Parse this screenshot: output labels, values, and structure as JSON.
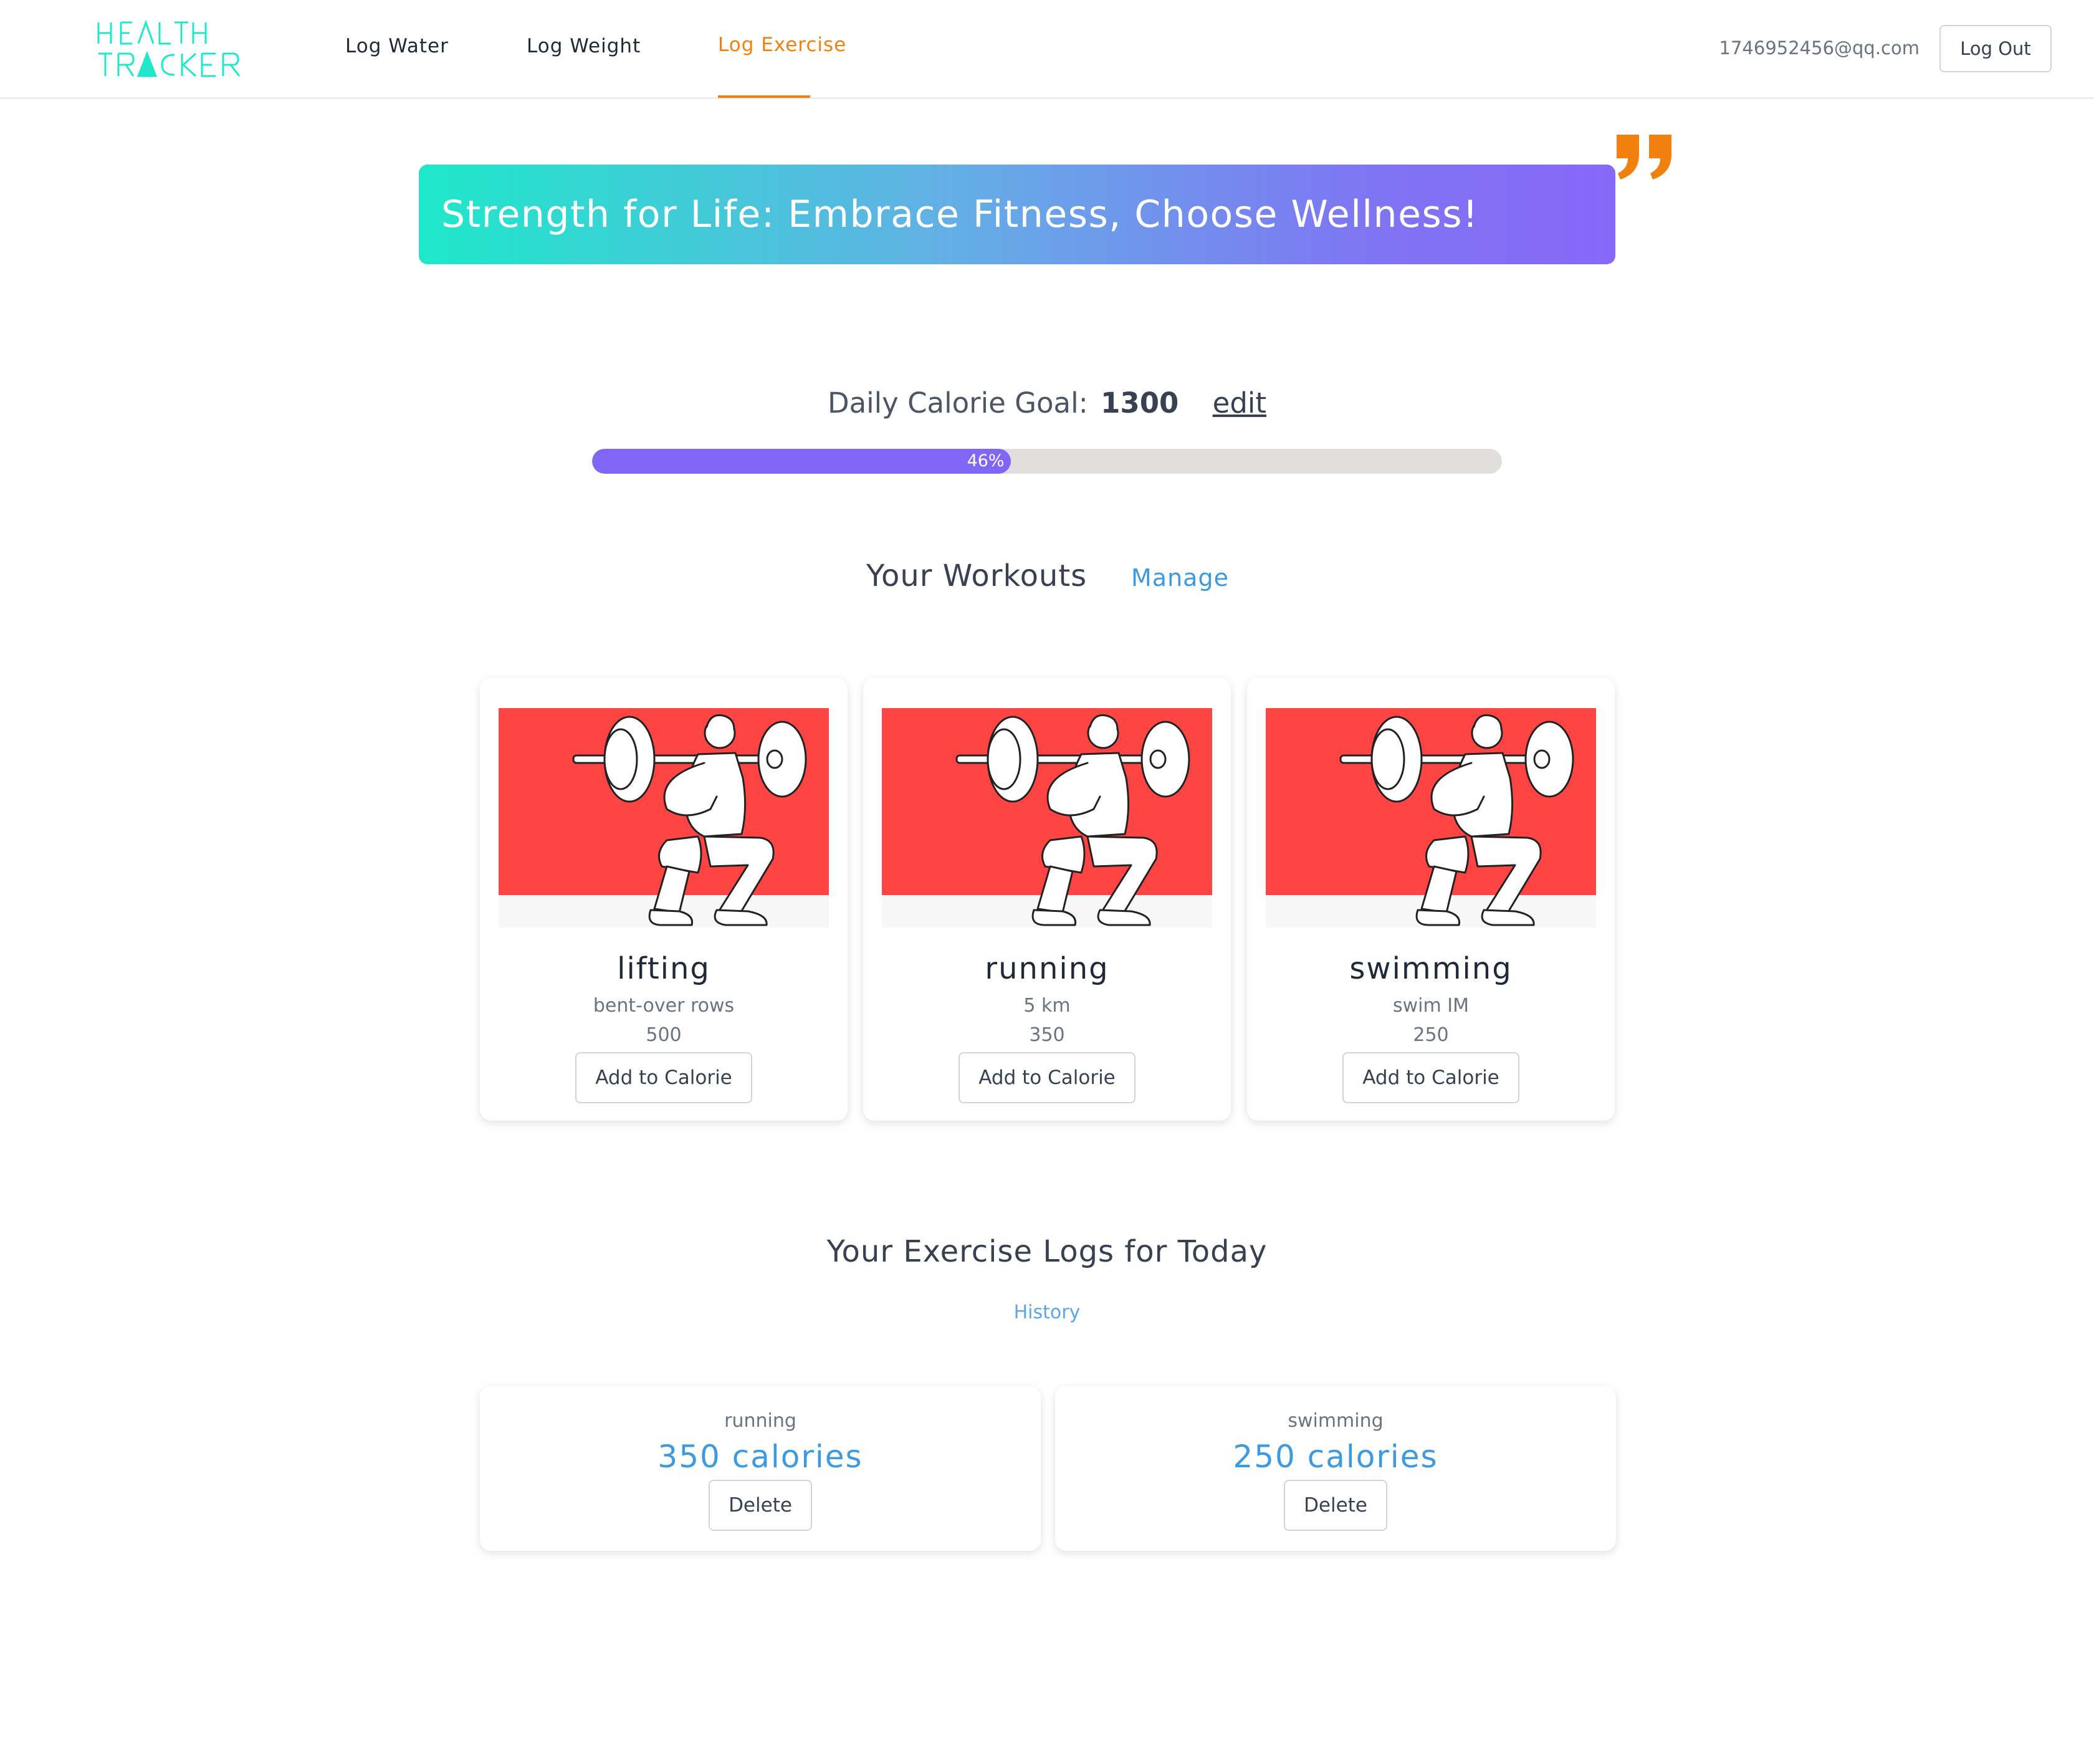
{
  "nav": {
    "logo_text": "HEALTH TRACKER",
    "links": [
      "Log Water",
      "Log Weight",
      "Log Exercise"
    ],
    "active": "Log Exercise",
    "email": "1746952456@qq.com",
    "logout_label": "Log Out"
  },
  "banner": {
    "text": "Strength for Life: Embrace Fitness, Choose Wellness!",
    "quote_icon": "quote-icon"
  },
  "goal": {
    "label": "Daily Calorie Goal:",
    "value": "1300",
    "edit_label": "edit",
    "progress_percent": 46,
    "progress_label": "46%"
  },
  "workouts": {
    "title": "Your Workouts",
    "manage_label": "Manage",
    "items": [
      {
        "name": "lifting",
        "detail": "bent-over rows",
        "calories": "500",
        "button": "Add to Calorie"
      },
      {
        "name": "running",
        "detail": "5 km",
        "calories": "350",
        "button": "Add to Calorie"
      },
      {
        "name": "swimming",
        "detail": "swim IM",
        "calories": "250",
        "button": "Add to Calorie"
      }
    ]
  },
  "logs": {
    "title": "Your Exercise Logs for Today",
    "history_label": "History",
    "items": [
      {
        "name": "running",
        "calories": "350 calories",
        "button": "Delete"
      },
      {
        "name": "swimming",
        "calories": "250 calories",
        "button": "Delete"
      }
    ]
  },
  "colors": {
    "accent": "#f0810f",
    "link_blue": "#3b9ae1",
    "progress_fill": "#8066f7",
    "logo": "#1ee8c9",
    "card_image_bg": "#ff4444"
  }
}
